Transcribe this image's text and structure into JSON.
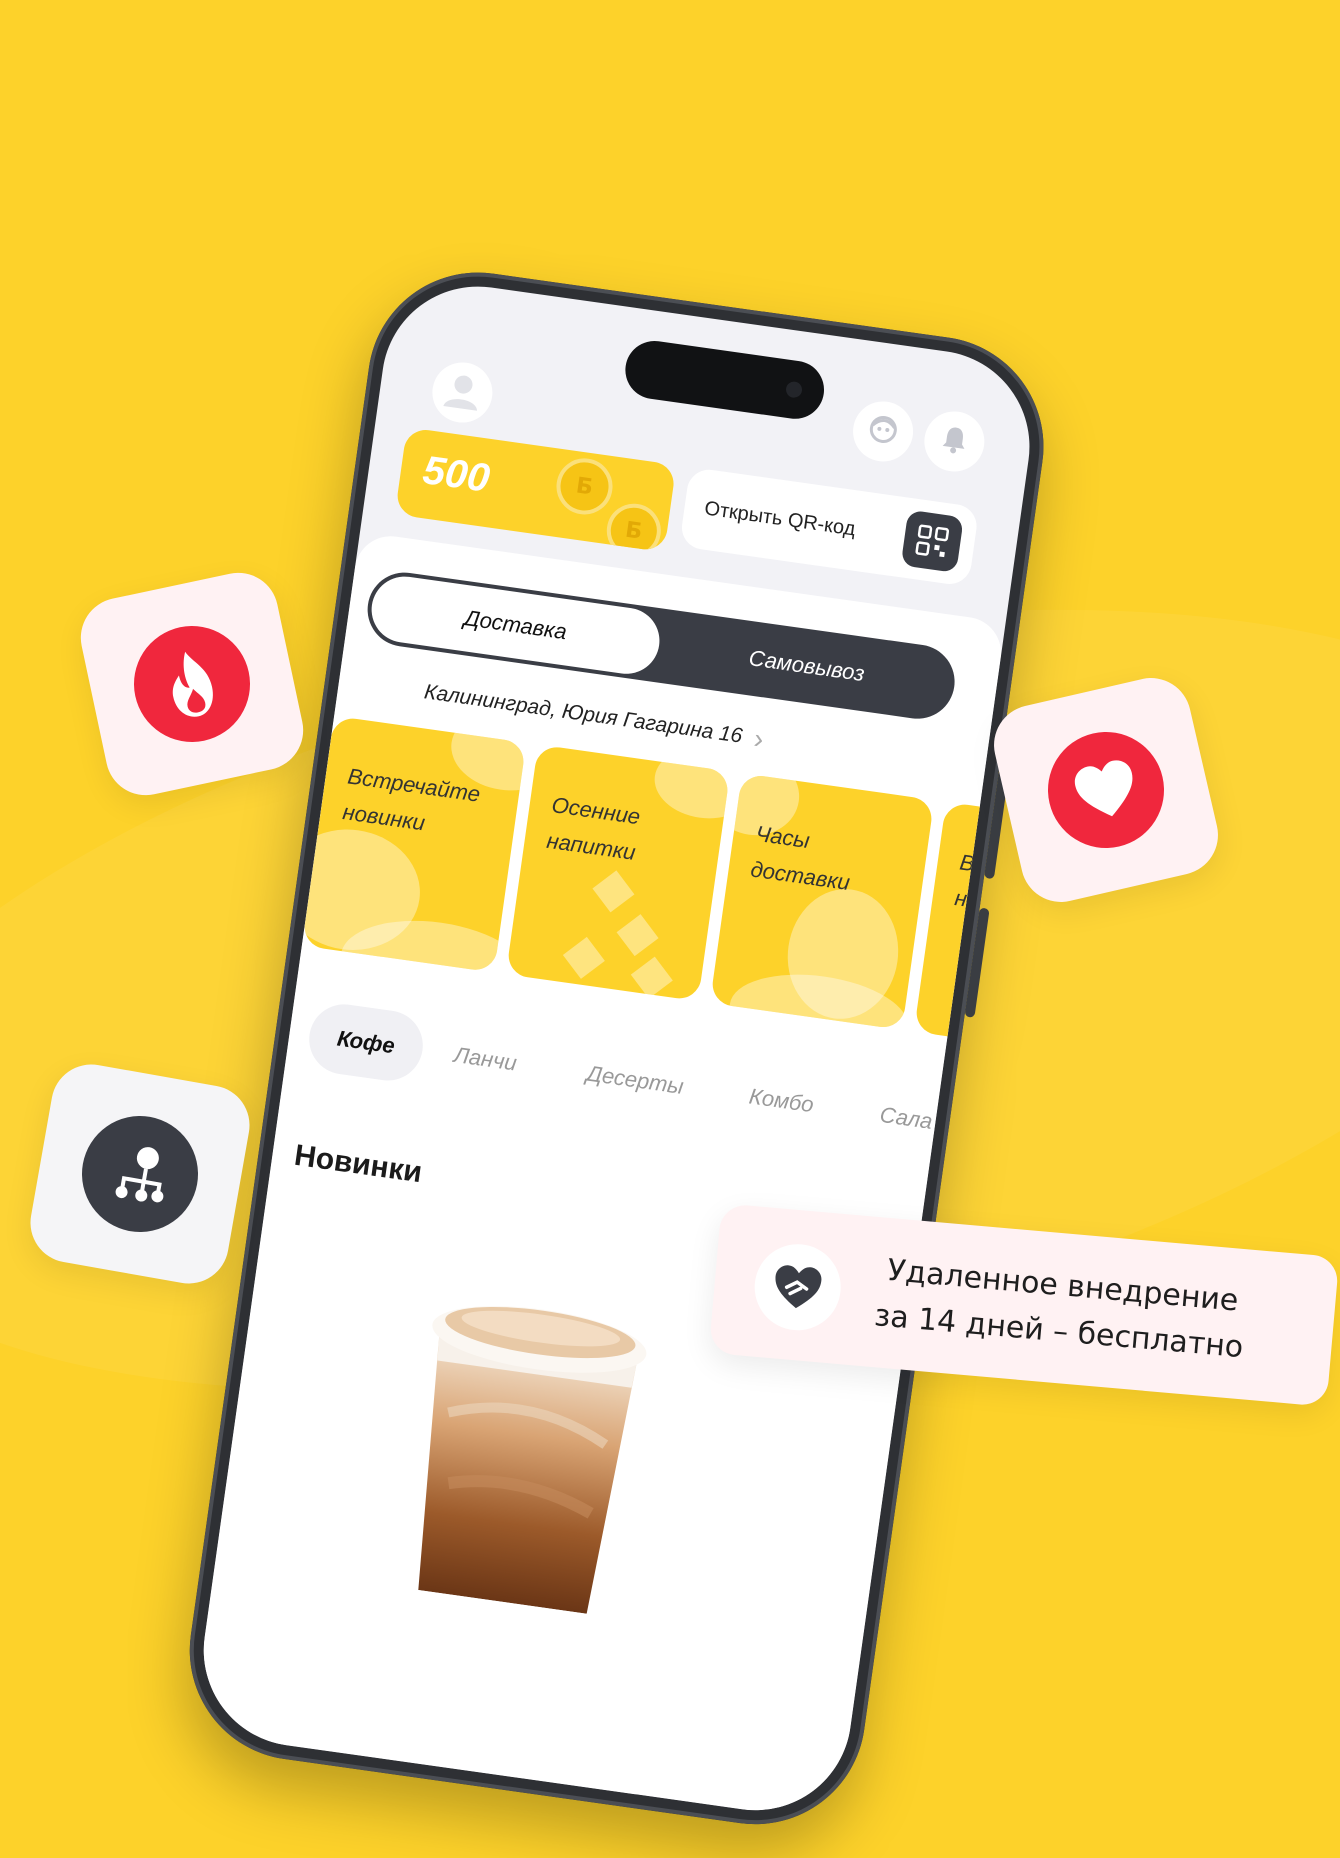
{
  "colors": {
    "background": "#FDD22A",
    "accent_yellow": "#FDD22A",
    "dark": "#3A3D45",
    "red": "#F0273D",
    "badge_bg": "#FFF2F3"
  },
  "header": {
    "avatar_icon": "user-avatar-icon",
    "support_icon": "support-agent-icon",
    "notifications_icon": "bell-icon"
  },
  "bonus": {
    "value": "500",
    "coin_letter": "Б"
  },
  "qr": {
    "label": "Открыть QR-код",
    "icon": "qr-code-icon"
  },
  "delivery_toggle": {
    "active": "Доставка",
    "inactive": "Самовывоз"
  },
  "address": {
    "text": "Калининград, Юрия Гагарина 16"
  },
  "promos": [
    {
      "title": "Встречайте\nновинки"
    },
    {
      "title": "Осенние\nнапитки"
    },
    {
      "title": "Часы\nдоставки"
    },
    {
      "title": "В\nн"
    }
  ],
  "categories": [
    "Кофе",
    "Ланчи",
    "Десерты",
    "Комбо",
    "Сала"
  ],
  "section": {
    "title": "Новинки"
  },
  "badges": {
    "fire_icon": "fire-icon",
    "heart_icon": "heart-icon",
    "network_icon": "network-icon"
  },
  "note": {
    "icon": "handshake-heart-icon",
    "text": "Удаленное внедрение\nза 14 дней – бесплатно"
  }
}
